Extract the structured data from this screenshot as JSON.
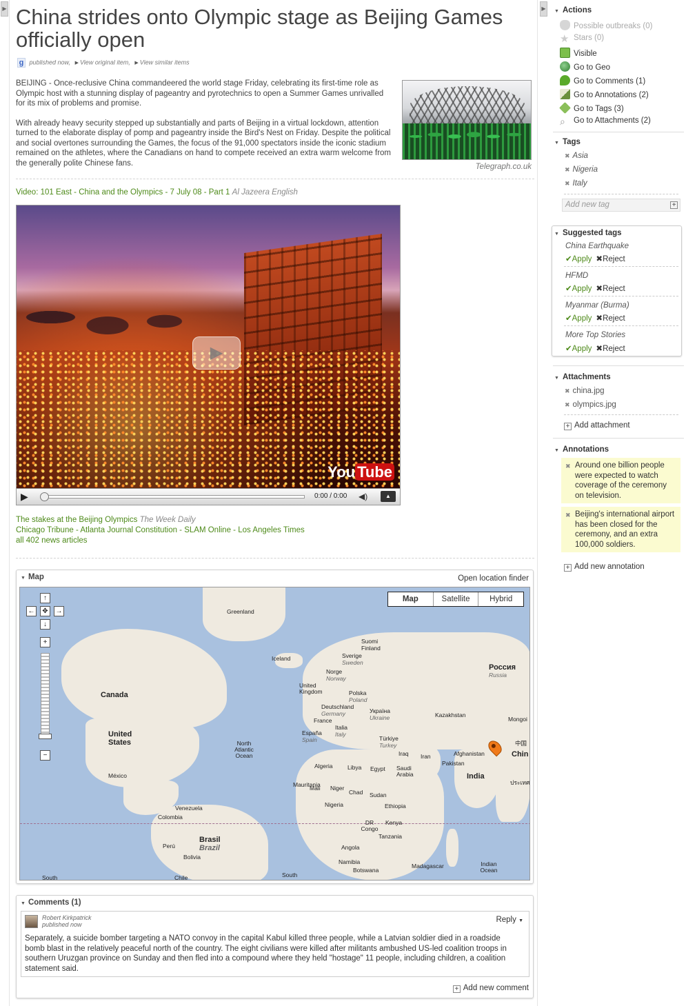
{
  "article": {
    "title": "China strides onto Olympic stage as Beijing Games officially open",
    "published": "published now,",
    "view_original": "View original item,",
    "view_similar": "View similar items",
    "paragraphs": [
      "BEIJING - Once-reclusive China commandeered the world stage Friday, celebrating its first-time role as Olympic host with a stunning display of pageantry and pyrotechnics to open a Summer Games unrivalled for its mix of problems and promise.",
      "With already heavy security stepped up substantially and parts of Beijing in a virtual lockdown, attention turned to the elaborate display of pomp and pageantry inside the Bird's Nest on Friday. Despite the political and social overtones surrounding the Games, the focus of the 91,000 spectators inside the iconic stadium remained on the athletes, where the Canadians on hand to compete received an extra warm welcome from the generally polite Chinese fans."
    ],
    "photo_caption": "Telegraph.co.uk"
  },
  "video": {
    "title": "Video: 101 East - China and the Olympics - 7 July 08 - Part 1",
    "source": "Al Jazeera English",
    "time": "0:00 / 0:00",
    "logo_you": "You",
    "logo_tube": "Tube"
  },
  "related": {
    "headline": "The stakes at the Beijing Olympics",
    "headline_source": "The Week Daily",
    "sources": [
      "Chicago Tribune",
      "Atlanta Journal Constitution",
      "SLAM Online",
      "Los Angeles Times"
    ],
    "separator": " - ",
    "all_articles": "all 402 news articles"
  },
  "map": {
    "header": "Map",
    "open_finder": "Open location finder",
    "types": [
      "Map",
      "Satellite",
      "Hybrid"
    ],
    "selected_type": "Map",
    "labels": {
      "greenland": "Greenland",
      "canada": "Canada",
      "united_states": "United States",
      "mexico": "México",
      "venezuela": "Venezuela",
      "colombia": "Colombia",
      "peru": "Perú",
      "brasil": "Brasil",
      "brazil": "Brazil",
      "bolivia": "Bolivia",
      "chile": "Chile",
      "south_a": "South",
      "south_b": "South",
      "north_atlantic_ocean": "North Atlantic Ocean",
      "iceland": "Iceland",
      "suomi": "Suomi",
      "finland": "Finland",
      "sverige": "Sverige",
      "sweden": "Sweden",
      "norge": "Norge",
      "norway": "Norway",
      "united_kingdom": "United Kingdom",
      "polska": "Polska",
      "poland": "Poland",
      "deutschland": "Deutschland",
      "germany": "Germany",
      "france": "France",
      "espana": "España",
      "spain": "Spain",
      "italia": "Italia",
      "italy": "Italy",
      "ukraina": "Україна",
      "ukraine": "Ukraine",
      "rossiya": "Россия",
      "russia": "Russia",
      "kazakhstan": "Kazakhstan",
      "mongolia": "Mongoi",
      "turkiye": "Türkiye",
      "turkey": "Turkey",
      "iraq": "Iraq",
      "iran": "Iran",
      "afghanistan": "Afghanistan",
      "pakistan": "Pakistan",
      "saudi_arabia": "Saudi Arabia",
      "india": "India",
      "china": "Chin",
      "china_cjk": "中国",
      "thailand": "ประเทศ",
      "algeria": "Algeria",
      "libya": "Libya",
      "egypt": "Egypt",
      "mauritania": "Mauritania",
      "mali": "Mali",
      "niger": "Niger",
      "chad": "Chad",
      "sudan": "Sudan",
      "nigeria": "Nigeria",
      "ethiopia": "Ethiopia",
      "kenya": "Kenya",
      "dr_congo": "DR Congo",
      "tanzania": "Tanzania",
      "angola": "Angola",
      "namibia": "Namibia",
      "botswana": "Botswana",
      "madagascar": "Madagascar",
      "indian_ocean": "Indian Ocean"
    }
  },
  "comments": {
    "header": "Comments (1)",
    "items": [
      {
        "author": "Robert Kirkpatrick",
        "time": "published now",
        "reply": "Reply",
        "body": "Separately, a suicide bomber targeting a NATO convoy in the capital Kabul killed three people, while a Latvian soldier died in a roadside bomb blast in the relatively peaceful north of the country. The eight civilians were killed after militants ambushed US-led coalition troops in southern Uruzgan province on Sunday and then fled into a compound where they held \"hostage\" 11 people, including children, a coalition statement said."
      }
    ],
    "add": "Add new comment"
  },
  "sidebar": {
    "actions_header": "Actions",
    "actions": [
      {
        "label": "Possible outbreaks (0)",
        "icon": "shield-icon",
        "color": "#cfcfcf",
        "enabled": false
      },
      {
        "label": "Stars (0)",
        "icon": "star-icon",
        "color": "#d6d6d6",
        "enabled": false
      },
      {
        "label": "Visible",
        "icon": "visible-icon",
        "color": "#7cbf4a",
        "enabled": true
      },
      {
        "label": "Go to Geo",
        "icon": "globe-icon",
        "color": "#3f9a3f",
        "enabled": true
      },
      {
        "label": "Go to Comments (1)",
        "icon": "comment-icon",
        "color": "#5aaa2a",
        "enabled": true
      },
      {
        "label": "Go to Annotations (2)",
        "icon": "pencil-icon",
        "color": "#6b8f3a",
        "enabled": true
      },
      {
        "label": "Go to Tags (3)",
        "icon": "tag-icon",
        "color": "#8bbf5a",
        "enabled": true
      },
      {
        "label": "Go to Attachments (2)",
        "icon": "paperclip-icon",
        "color": "#9a9a9a",
        "enabled": true
      }
    ],
    "tags_header": "Tags",
    "tags": [
      "Asia",
      "Nigeria",
      "Italy"
    ],
    "add_tag_placeholder": "Add new tag",
    "suggested_header": "Suggested tags",
    "suggested": [
      "China Earthquake",
      "HFMD",
      "Myanmar (Burma)",
      "More Top Stories"
    ],
    "apply_label": "Apply",
    "reject_label": "Reject",
    "attachments_header": "Attachments",
    "attachments": [
      "china.jpg",
      "olympics.jpg"
    ],
    "add_attachment": "Add attachment",
    "annotations_header": "Annotations",
    "annotations": [
      "Around one billion people were expected to watch coverage of the ceremony on television.",
      "Beijing's international airport has been closed for the ceremony, and an extra 100,000 soldiers."
    ],
    "add_annotation": "Add new annotation"
  },
  "colors": {
    "link_green": "#4e8a1a",
    "annotation_bg": "#fbfbd0",
    "water": "#a9c1df",
    "land": "#efeae0",
    "pin": "#f07a1a"
  }
}
